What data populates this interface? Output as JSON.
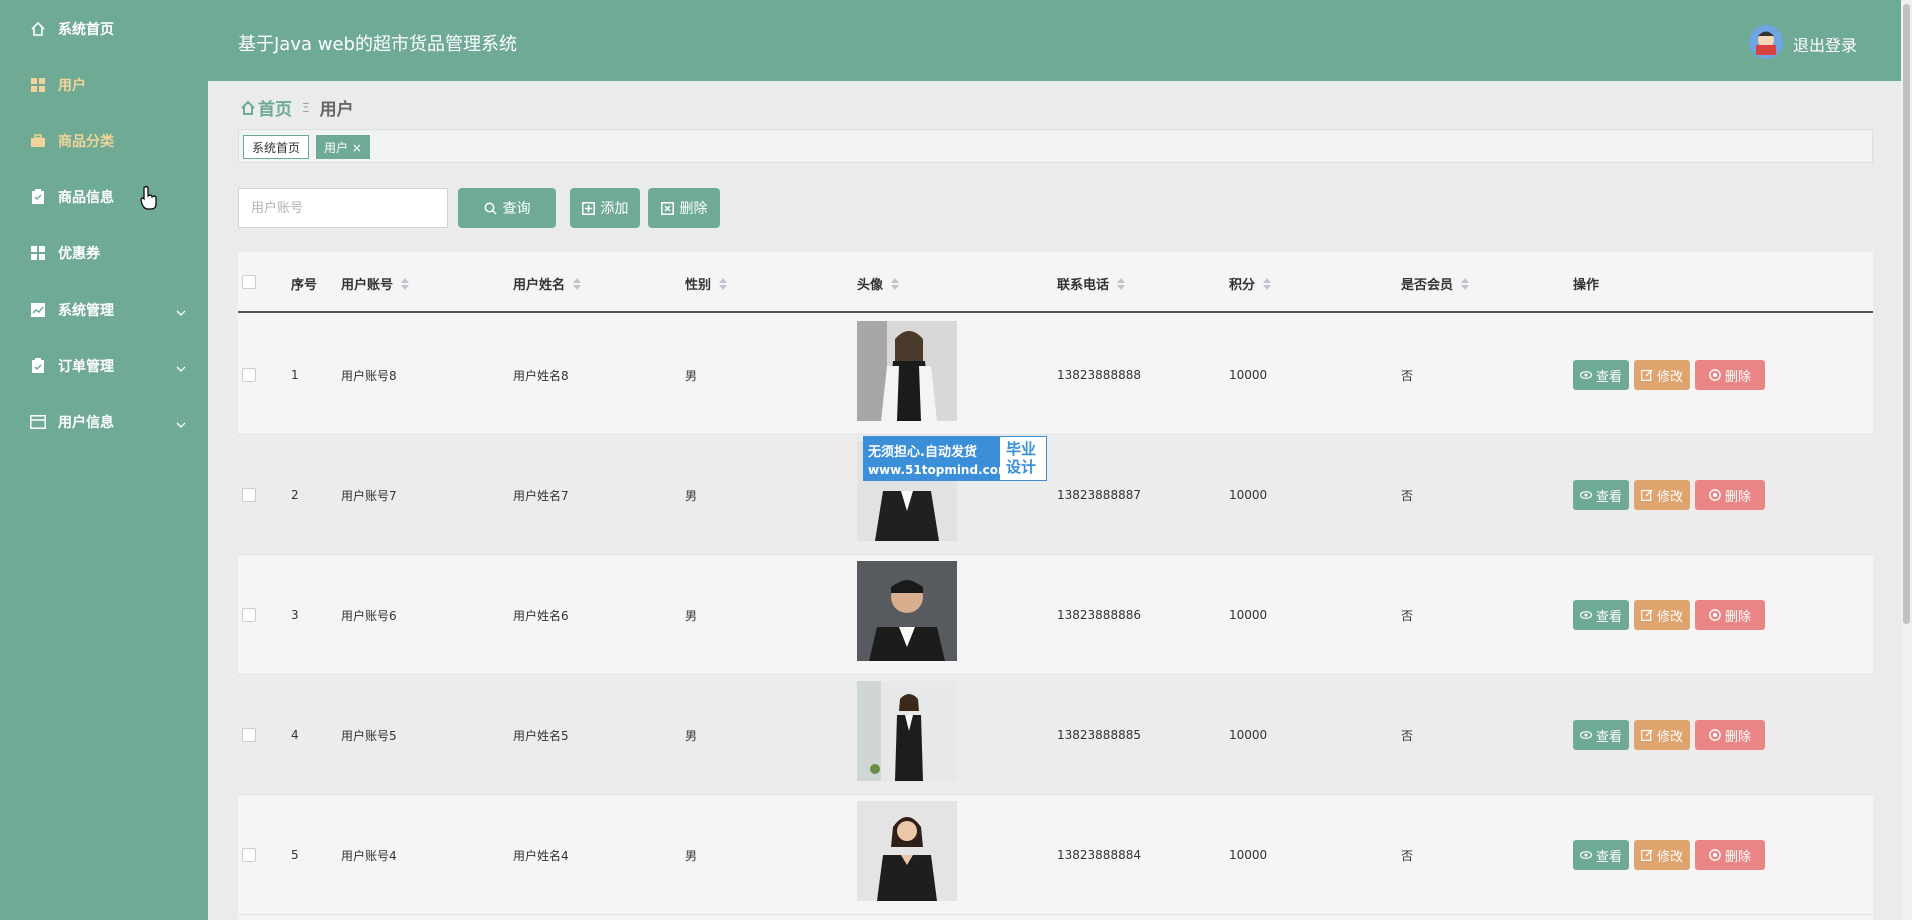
{
  "sidebar": {
    "items": [
      {
        "label": "系统首页",
        "icon": "home-icon"
      },
      {
        "label": "用户",
        "icon": "grid-icon"
      },
      {
        "label": "商品分类",
        "icon": "briefcase-icon"
      },
      {
        "label": "商品信息",
        "icon": "clipboard-icon"
      },
      {
        "label": "优惠券",
        "icon": "grid-icon"
      },
      {
        "label": "系统管理",
        "icon": "chart-icon"
      },
      {
        "label": "订单管理",
        "icon": "clipboard-check-icon"
      },
      {
        "label": "用户信息",
        "icon": "card-icon"
      }
    ]
  },
  "header": {
    "title": "基于Java web的超市货品管理系统",
    "logout": "退出登录"
  },
  "breadcrumb": {
    "home": "首页",
    "separator": "Ξ",
    "current": "用户"
  },
  "tags": {
    "tag1": "系统首页",
    "tag2": "用户 ×"
  },
  "search": {
    "placeholder": "用户账号",
    "query_label": "查询",
    "add_label": "添加",
    "delete_label": "删除"
  },
  "table": {
    "headers": {
      "index": "序号",
      "account": "用户账号",
      "name": "用户姓名",
      "gender": "性别",
      "avatar": "头像",
      "phone": "联系电话",
      "points": "积分",
      "member": "是否会员",
      "actions": "操作"
    },
    "rows": [
      {
        "index": "1",
        "account": "用户账号8",
        "name": "用户姓名8",
        "gender": "男",
        "phone": "13823888888",
        "points": "10000",
        "member": "否"
      },
      {
        "index": "2",
        "account": "用户账号7",
        "name": "用户姓名7",
        "gender": "男",
        "phone": "13823888887",
        "points": "10000",
        "member": "否"
      },
      {
        "index": "3",
        "account": "用户账号6",
        "name": "用户姓名6",
        "gender": "男",
        "phone": "13823888886",
        "points": "10000",
        "member": "否"
      },
      {
        "index": "4",
        "account": "用户账号5",
        "name": "用户姓名5",
        "gender": "男",
        "phone": "13823888885",
        "points": "10000",
        "member": "否"
      },
      {
        "index": "5",
        "account": "用户账号4",
        "name": "用户姓名4",
        "gender": "男",
        "phone": "13823888884",
        "points": "10000",
        "member": "否"
      }
    ],
    "actions": {
      "view": "查看",
      "edit": "修改",
      "delete": "删除"
    }
  },
  "watermark": {
    "line1": "无须担心.自动发货",
    "line2": "www.51topmind.com",
    "right": "毕业设计"
  },
  "colors": {
    "primary": "#6faa94",
    "edit": "#dfa36e",
    "delete": "#e98585",
    "active_menu": "#f2d39b"
  }
}
